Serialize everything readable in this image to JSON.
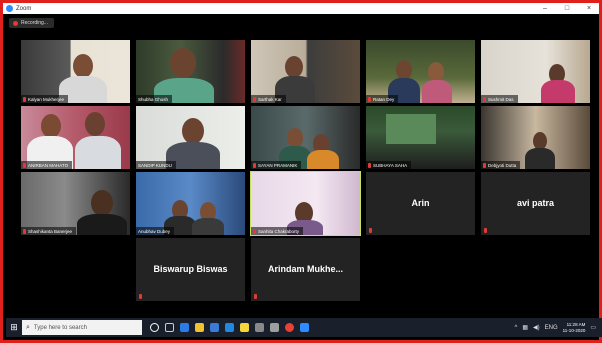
{
  "window": {
    "title": "Zoom",
    "controls": [
      "–",
      "□",
      "×"
    ]
  },
  "recording": {
    "label": "Recording..."
  },
  "participants": [
    {
      "name": "Kalyan Mukherjee",
      "video": true,
      "active": false
    },
    {
      "name": "Shubha Ghosh",
      "video": true,
      "active": false
    },
    {
      "name": "Sarthak Kar",
      "video": true,
      "active": false
    },
    {
      "name": "Ratan Dey",
      "video": true,
      "active": false
    },
    {
      "name": "Sushmit Das",
      "video": true,
      "active": false
    },
    {
      "name": "ANIRBAN MAHATO",
      "video": true,
      "active": false
    },
    {
      "name": "SANDIP KUNDU",
      "video": true,
      "active": false
    },
    {
      "name": "SAYAN PRAMANIK",
      "video": true,
      "active": false
    },
    {
      "name": "SUBHAYA SAHA",
      "video": true,
      "active": false
    },
    {
      "name": "Debjyoti Dutta",
      "video": true,
      "active": false
    },
    {
      "name": "Shashikanta Banerjee",
      "video": true,
      "active": false
    },
    {
      "name": "Anubhav Dubey",
      "video": true,
      "active": false
    },
    {
      "name": "Sanhita Chakraborty",
      "video": true,
      "active": true
    },
    {
      "name": "Arin",
      "video": false,
      "active": false
    },
    {
      "name": "avi patra",
      "video": false,
      "active": false
    },
    {
      "name": "Biswarup Biswas",
      "video": false,
      "active": false
    },
    {
      "name": "Arindam  Mukhe...",
      "video": false,
      "active": false
    }
  ],
  "taskbar": {
    "start_icon": "windows-icon",
    "search_placeholder": "Type here to search",
    "pinned": [
      {
        "icon": "cortana-icon",
        "color": "#ffffff"
      },
      {
        "icon": "task-view-icon",
        "color": "#cccccc"
      },
      {
        "icon": "edge-icon",
        "color": "#2d7be5"
      },
      {
        "icon": "file-explorer-icon",
        "color": "#f2c12e"
      },
      {
        "icon": "store-icon",
        "color": "#3a7bd5"
      },
      {
        "icon": "mail-icon",
        "color": "#1e88e5"
      },
      {
        "icon": "sticky-notes-icon",
        "color": "#f5d63d"
      },
      {
        "icon": "app-icon",
        "color": "#888888"
      },
      {
        "icon": "settings-icon",
        "color": "#9e9e9e"
      },
      {
        "icon": "chrome-icon",
        "color": "#e94235"
      },
      {
        "icon": "zoom-icon",
        "color": "#2d8cff"
      }
    ],
    "tray": {
      "lang": "ENG",
      "time": "11:28 AM",
      "date": "11-10-2020"
    }
  }
}
